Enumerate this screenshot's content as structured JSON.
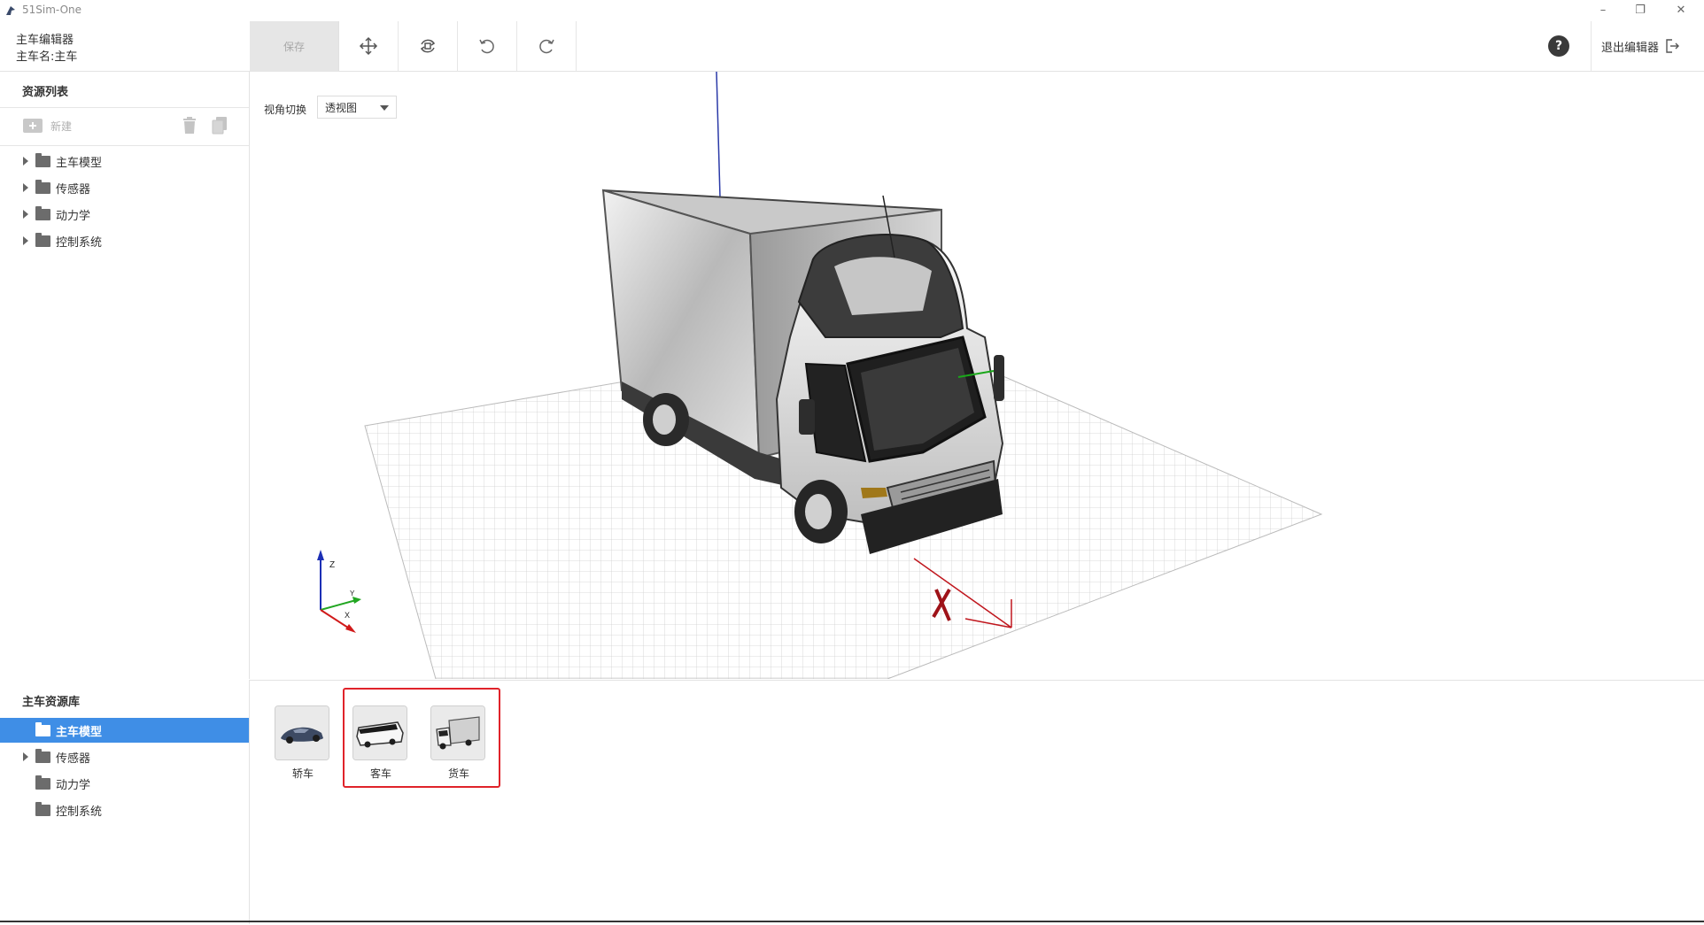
{
  "window": {
    "title": "51Sim-One"
  },
  "header": {
    "editor_title": "主车编辑器",
    "vehicle_name": "主车名:主车",
    "save_label": "保存",
    "exit_label": "退出编辑器"
  },
  "resource_list": {
    "title": "资源列表",
    "new_label": "新建",
    "items": [
      {
        "label": "主车模型"
      },
      {
        "label": "传感器"
      },
      {
        "label": "动力学"
      },
      {
        "label": "控制系统"
      }
    ]
  },
  "viewport": {
    "view_switch_label": "视角切换",
    "view_selected": "透视图"
  },
  "library": {
    "title": "主车资源库",
    "items": [
      {
        "label": "主车模型",
        "selected": true
      },
      {
        "label": "传感器"
      },
      {
        "label": "动力学"
      },
      {
        "label": "控制系统"
      }
    ],
    "cards": [
      {
        "label": "轿车",
        "icon": "sedan-icon"
      },
      {
        "label": "客车",
        "icon": "bus-icon"
      },
      {
        "label": "货车",
        "icon": "truck-icon"
      }
    ]
  },
  "colors": {
    "selection": "#3f8ee6",
    "highlight_border": "#e0232a"
  }
}
